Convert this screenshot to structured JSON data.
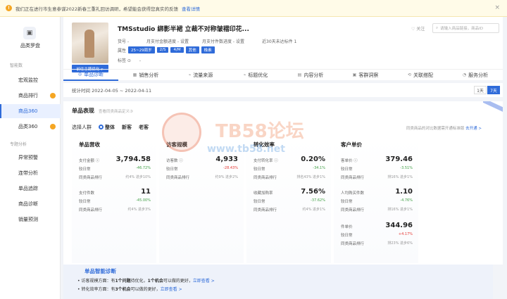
{
  "notice": {
    "text": "我们正在进行市生意参谋2022新春三重礼回访调研，希望能会获得您真实的反馈",
    "link": "查看详情",
    "close": "×"
  },
  "sidebar": {
    "title": "品类罗盘",
    "section1": "智能数",
    "items1": [
      {
        "label": "宏观监控",
        "dot": false,
        "active": false
      },
      {
        "label": "商品排行",
        "dot": true,
        "active": false
      },
      {
        "label": "商品360",
        "dot": false,
        "active": true
      },
      {
        "label": "品类360",
        "dot": true,
        "active": false
      }
    ],
    "section2": "专题分析",
    "items2": [
      {
        "label": "异常预警"
      },
      {
        "label": "连带分析"
      },
      {
        "label": "单品追踪"
      },
      {
        "label": "商品诊断"
      },
      {
        "label": "销量预测"
      }
    ]
  },
  "product": {
    "title": "TMSstudio 綁影半裙 立裁不对称皱褶印花...",
    "goto_button": "前往主题优化 >",
    "fav": "♡ 关注",
    "search_placeholder": "请输入商品链接，商品ID",
    "meta1": "货号 -",
    "meta2": "月支付金额进度 - 设置",
    "meta3": "月支付件数进度 - 设置",
    "meta4": "近30天未达标件 1",
    "attr_label": "属性",
    "chips": [
      "25~29周岁",
      "2/S",
      "4/M",
      "其他",
      "橡素"
    ],
    "tag_label": "标签 ⊙",
    "tag_value": "-"
  },
  "tabs": [
    {
      "label": "单品诊断",
      "icon": "◎",
      "active": true
    },
    {
      "label": "销售分析",
      "icon": "▦",
      "active": false
    },
    {
      "label": "流量来源",
      "icon": "⌁",
      "active": false
    },
    {
      "label": "标题优化",
      "icon": "⌁",
      "active": false
    },
    {
      "label": "内容分析",
      "icon": "▤",
      "active": false
    },
    {
      "label": "客群洞察",
      "icon": "▣",
      "active": false
    },
    {
      "label": "关联搭配",
      "icon": "⟲",
      "active": false
    },
    {
      "label": "服务分析",
      "icon": "◔",
      "active": false
    }
  ],
  "dates": {
    "text": "统计时间 2022-04-05 ~ 2022-04-11",
    "btn1": "1天",
    "btn7": "7天"
  },
  "panel": {
    "title": "单品表现",
    "subtitle": "查看同类商品定义③",
    "crowd_label": "选择人群",
    "crowd_options": [
      "整体",
      "新客",
      "老客"
    ],
    "tip": "同类商品的对比数据需开通标准版",
    "tip_link": "去开通 >"
  },
  "metrics": [
    {
      "title": "单品营收",
      "rows": [
        {
          "label": "支付金额 ⓘ",
          "value": "3,794.58",
          "change": "-46.72%",
          "rank": "约4% 进步10%",
          "change_dir": "down"
        },
        {
          "label": "支付件数",
          "value": "11",
          "change": "-45.00%",
          "rank": "约4% 进步3%",
          "change_dir": "down"
        }
      ]
    },
    {
      "title": "访客规模",
      "rows": [
        {
          "label": "访客数 ⓘ",
          "value": "4,933",
          "change": "-28.43%",
          "rank": "约9% 进步2%",
          "change_dir": "up"
        }
      ]
    },
    {
      "title": "转化效率",
      "rows": [
        {
          "label": "支付转化率 ⓘ",
          "value": "0.20%",
          "change": "-34.1%",
          "rank": "排名43% 进步1%",
          "change_dir": "down"
        },
        {
          "label": "收藏加购率",
          "value": "7.56%",
          "change": "-37.62%",
          "rank": "约4% 进步1%",
          "change_dir": "down"
        }
      ]
    },
    {
      "title": "客户单价",
      "rows": [
        {
          "label": "客单价 ⓘ",
          "value": "379.46",
          "change": "-3.51%",
          "rank": "排16% 进步1%",
          "change_dir": "down"
        },
        {
          "label": "人均购买件数",
          "value": "1.10",
          "change": "-4.76%",
          "rank": "排16% 进步1%",
          "change_dir": "down"
        },
        {
          "label": "件单价",
          "value": "344.96",
          "change": "+4.17%",
          "rank": "排23% 进步6%",
          "change_dir": "up"
        }
      ]
    }
  ],
  "row_labels": {
    "compare": "较日常",
    "rank": "同类商品排行"
  },
  "watermark": {
    "text": "TB58论坛",
    "url": "www.tb58.net"
  },
  "diagnosis": {
    "title": "单品智能诊断",
    "line1_pre": "• 访客规模方面：有",
    "line1_b1": "1个问题",
    "line1_mid": "待优化，",
    "line1_b2": "1个机会",
    "line1_post": "可以做的更好，",
    "line1_link": "立即查看 >",
    "line2_pre": "• 转化效率方面：有",
    "line2_b1": "3个机会",
    "line2_post": "可以做的更好，",
    "line2_link": "立即查看 >"
  }
}
